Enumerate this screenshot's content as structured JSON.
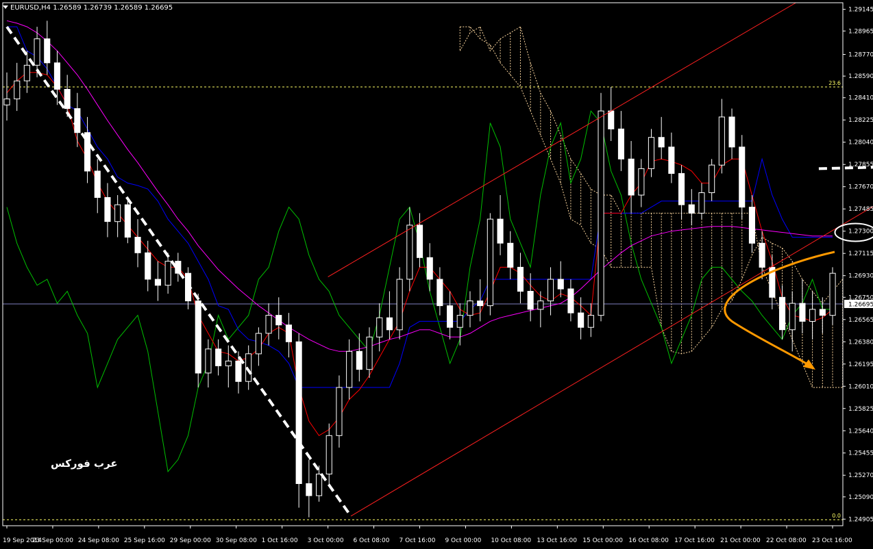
{
  "header": {
    "symbol": "EURUSD,H4",
    "quotes": "1.26589 1.26739 1.26589 1.26695"
  },
  "watermark": "عرب فوركس",
  "colors": {
    "background": "#000000",
    "axis": "#ffffff",
    "candle": "#ffffff",
    "tenkan": "#ff0000",
    "kijun": "#0000ff",
    "chikou": "#00c000",
    "ma": "#ff00ff",
    "cloud": "#ffd9a0",
    "fib": "#ffff66",
    "channel": "#ff2020",
    "trend_marker": "#ffffff",
    "forecast_arrow": "#ff9900",
    "price_line": "#8080c0"
  },
  "chart_data": {
    "type": "candlestick",
    "symbol": "EURUSD",
    "timeframe": "H4",
    "ylim": [
      1.2485,
      1.292
    ],
    "y_ticks": [
      "1.29145",
      "1.28965",
      "1.28770",
      "1.28590",
      "1.28410",
      "1.28225",
      "1.28040",
      "1.27855",
      "1.27670",
      "1.27485",
      "1.27300",
      "1.27115",
      "1.26930",
      "1.26750",
      "1.26565",
      "1.26380",
      "1.26195",
      "1.26010",
      "1.25825",
      "1.25640",
      "1.25455",
      "1.25270",
      "1.25090",
      "1.24905"
    ],
    "x_ticks": [
      "19 Sep 2014",
      "23 Sep 00:00",
      "24 Sep 08:00",
      "25 Sep 16:00",
      "29 Sep 00:00",
      "30 Sep 08:00",
      "1 Oct 16:00",
      "3 Oct 00:00",
      "6 Oct 08:00",
      "7 Oct 16:00",
      "9 Oct 00:00",
      "10 Oct 08:00",
      "13 Oct 16:00",
      "15 Oct 00:00",
      "16 Oct 08:00",
      "17 Oct 16:00",
      "21 Oct 00:00",
      "22 Oct 08:00",
      "23 Oct 16:00"
    ],
    "current_price": "1.26695",
    "fib_levels": [
      {
        "label": "23.6",
        "price": 1.285
      },
      {
        "label": "0.0",
        "price": 1.249
      }
    ],
    "annotations": [
      {
        "type": "trendline",
        "style": "dashed-white",
        "from": [
          0.0,
          1.29
        ],
        "to": [
          7.5,
          1.2493
        ]
      },
      {
        "type": "channel",
        "color": "red",
        "lower_from": [
          7.5,
          1.2493
        ],
        "lower_to": [
          19.3,
          1.276
        ],
        "upper_from": [
          7.0,
          1.2692
        ],
        "upper_to": [
          17.2,
          1.292
        ]
      },
      {
        "type": "dash-marker",
        "at": [
          17.7,
          1.2782
        ]
      },
      {
        "type": "ellipse-marker",
        "at": [
          18.5,
          1.2729
        ]
      },
      {
        "type": "forecast-arrow",
        "color": "orange"
      }
    ],
    "series": [
      {
        "name": "price",
        "kind": "candles",
        "ohlc": [
          [
            1.2835,
            1.2862,
            1.2822,
            1.284
          ],
          [
            1.284,
            1.287,
            1.283,
            1.2855
          ],
          [
            1.2855,
            1.288,
            1.2845,
            1.2868
          ],
          [
            1.2868,
            1.29,
            1.2858,
            1.289
          ],
          [
            1.289,
            1.2905,
            1.286,
            1.287
          ],
          [
            1.287,
            1.288,
            1.2835,
            1.2848
          ],
          [
            1.2848,
            1.286,
            1.2825,
            1.2832
          ],
          [
            1.2832,
            1.2845,
            1.28,
            1.2812
          ],
          [
            1.2812,
            1.2825,
            1.277,
            1.278
          ],
          [
            1.278,
            1.279,
            1.2745,
            1.2758
          ],
          [
            1.2758,
            1.277,
            1.2725,
            1.2738
          ],
          [
            1.2738,
            1.276,
            1.2725,
            1.2752
          ],
          [
            1.2752,
            1.2758,
            1.272,
            1.2725
          ],
          [
            1.2725,
            1.274,
            1.27,
            1.2712
          ],
          [
            1.2712,
            1.2722,
            1.268,
            1.269
          ],
          [
            1.269,
            1.2705,
            1.2672,
            1.2685
          ],
          [
            1.2685,
            1.2712,
            1.2678,
            1.2705
          ],
          [
            1.2705,
            1.2712,
            1.2688,
            1.2695
          ],
          [
            1.2695,
            1.27,
            1.2665,
            1.2672
          ],
          [
            1.2672,
            1.2678,
            1.26,
            1.2612
          ],
          [
            1.2612,
            1.264,
            1.26,
            1.2632
          ],
          [
            1.2632,
            1.264,
            1.261,
            1.2618
          ],
          [
            1.2618,
            1.2635,
            1.26,
            1.2622
          ],
          [
            1.2622,
            1.263,
            1.2595,
            1.2605
          ],
          [
            1.2605,
            1.2635,
            1.2598,
            1.2628
          ],
          [
            1.2628,
            1.265,
            1.2618,
            1.2645
          ],
          [
            1.2645,
            1.267,
            1.2635,
            1.266
          ],
          [
            1.266,
            1.2675,
            1.264,
            1.2652
          ],
          [
            1.2652,
            1.2662,
            1.2625,
            1.2638
          ],
          [
            1.2638,
            1.2645,
            1.25,
            1.252
          ],
          [
            1.252,
            1.254,
            1.2492,
            1.251
          ],
          [
            1.251,
            1.2535,
            1.2505,
            1.2528
          ],
          [
            1.2528,
            1.257,
            1.2518,
            1.256
          ],
          [
            1.256,
            1.261,
            1.255,
            1.26
          ],
          [
            1.26,
            1.264,
            1.259,
            1.263
          ],
          [
            1.263,
            1.2645,
            1.2605,
            1.2615
          ],
          [
            1.2615,
            1.265,
            1.2608,
            1.2642
          ],
          [
            1.2642,
            1.267,
            1.263,
            1.2658
          ],
          [
            1.2658,
            1.268,
            1.264,
            1.2648
          ],
          [
            1.2648,
            1.27,
            1.264,
            1.269
          ],
          [
            1.269,
            1.275,
            1.268,
            1.2735
          ],
          [
            1.2735,
            1.2745,
            1.27,
            1.2708
          ],
          [
            1.2708,
            1.272,
            1.268,
            1.269
          ],
          [
            1.269,
            1.27,
            1.266,
            1.2668
          ],
          [
            1.2668,
            1.268,
            1.264,
            1.265
          ],
          [
            1.265,
            1.267,
            1.2635,
            1.266
          ],
          [
            1.266,
            1.268,
            1.265,
            1.2672
          ],
          [
            1.2672,
            1.269,
            1.2655,
            1.2668
          ],
          [
            1.2668,
            1.2745,
            1.266,
            1.274
          ],
          [
            1.274,
            1.276,
            1.271,
            1.272
          ],
          [
            1.272,
            1.273,
            1.269,
            1.27
          ],
          [
            1.27,
            1.2712,
            1.267,
            1.268
          ],
          [
            1.268,
            1.2695,
            1.2655,
            1.2665
          ],
          [
            1.2665,
            1.268,
            1.265,
            1.2672
          ],
          [
            1.2672,
            1.27,
            1.266,
            1.269
          ],
          [
            1.269,
            1.2705,
            1.2675,
            1.2682
          ],
          [
            1.2682,
            1.269,
            1.2655,
            1.2662
          ],
          [
            1.2662,
            1.2675,
            1.264,
            1.265
          ],
          [
            1.265,
            1.267,
            1.2642,
            1.266
          ],
          [
            1.266,
            1.2845,
            1.2655,
            1.283
          ],
          [
            1.283,
            1.285,
            1.2805,
            1.2815
          ],
          [
            1.2815,
            1.283,
            1.278,
            1.279
          ],
          [
            1.279,
            1.2805,
            1.2745,
            1.276
          ],
          [
            1.276,
            1.279,
            1.275,
            1.2782
          ],
          [
            1.2782,
            1.2815,
            1.2775,
            1.2808
          ],
          [
            1.2808,
            1.2825,
            1.279,
            1.28
          ],
          [
            1.28,
            1.2812,
            1.277,
            1.2778
          ],
          [
            1.2778,
            1.2785,
            1.274,
            1.2752
          ],
          [
            1.2752,
            1.2765,
            1.2735,
            1.2745
          ],
          [
            1.2745,
            1.277,
            1.274,
            1.2762
          ],
          [
            1.2762,
            1.279,
            1.2755,
            1.2785
          ],
          [
            1.2785,
            1.284,
            1.2778,
            1.2825
          ],
          [
            1.2825,
            1.2832,
            1.279,
            1.28
          ],
          [
            1.28,
            1.281,
            1.274,
            1.275
          ],
          [
            1.275,
            1.276,
            1.2712,
            1.272
          ],
          [
            1.272,
            1.273,
            1.269,
            1.27
          ],
          [
            1.27,
            1.271,
            1.2665,
            1.2675
          ],
          [
            1.2675,
            1.2685,
            1.264,
            1.2648
          ],
          [
            1.2648,
            1.268,
            1.263,
            1.267
          ],
          [
            1.267,
            1.269,
            1.2645,
            1.2655
          ],
          [
            1.2655,
            1.268,
            1.264,
            1.2665
          ],
          [
            1.2665,
            1.2675,
            1.2645,
            1.266
          ],
          [
            1.266,
            1.27,
            1.2652,
            1.2695
          ]
        ]
      },
      {
        "name": "tenkan",
        "kind": "line",
        "color": "#ff0000",
        "values": [
          1.2845,
          1.2855,
          1.2862,
          1.2862,
          1.286,
          1.285,
          1.2835,
          1.2805,
          1.279,
          1.277,
          1.2755,
          1.2745,
          1.2735,
          1.2725,
          1.2715,
          1.2705,
          1.27,
          1.27,
          1.269,
          1.266,
          1.2645,
          1.263,
          1.2628,
          1.2622,
          1.2625,
          1.2632,
          1.2645,
          1.265,
          1.2645,
          1.26,
          1.2572,
          1.256,
          1.2565,
          1.2575,
          1.259,
          1.2598,
          1.261,
          1.2625,
          1.264,
          1.2655,
          1.268,
          1.27,
          1.27,
          1.269,
          1.268,
          1.2665,
          1.266,
          1.2662,
          1.268,
          1.27,
          1.27,
          1.2695,
          1.2685,
          1.2676,
          1.2672,
          1.2678,
          1.2675,
          1.2668,
          1.266,
          1.2745,
          1.2745,
          1.2745,
          1.276,
          1.277,
          1.2788,
          1.279,
          1.2788,
          1.2785,
          1.278,
          1.277,
          1.277,
          1.2785,
          1.279,
          1.279,
          1.276,
          1.273,
          1.2705,
          1.2675,
          1.266,
          1.2658,
          1.2655,
          1.2658,
          1.2665
        ]
      },
      {
        "name": "kijun",
        "kind": "line",
        "color": "#0000ff",
        "values": [
          1.29,
          1.29,
          1.288,
          1.2875,
          1.2865,
          1.285,
          1.2835,
          1.283,
          1.2815,
          1.28,
          1.279,
          1.2775,
          1.277,
          1.2768,
          1.2765,
          1.2755,
          1.274,
          1.273,
          1.272,
          1.2705,
          1.269,
          1.2668,
          1.2665,
          1.2648,
          1.264,
          1.2638,
          1.2635,
          1.263,
          1.262,
          1.26,
          1.26,
          1.26,
          1.26,
          1.26,
          1.26,
          1.26,
          1.26,
          1.26,
          1.26,
          1.262,
          1.265,
          1.2655,
          1.2655,
          1.2655,
          1.2655,
          1.2655,
          1.2665,
          1.2672,
          1.269,
          1.269,
          1.269,
          1.269,
          1.269,
          1.269,
          1.269,
          1.269,
          1.269,
          1.269,
          1.269,
          1.2745,
          1.2745,
          1.2745,
          1.2745,
          1.2745,
          1.275,
          1.2755,
          1.2755,
          1.2755,
          1.2755,
          1.2755,
          1.2755,
          1.2755,
          1.2755,
          1.2755,
          1.2755,
          1.279,
          1.276,
          1.274,
          1.2725,
          1.2725,
          1.2725,
          1.2725,
          1.2725
        ]
      },
      {
        "name": "chikou",
        "kind": "line",
        "color": "#00c000",
        "values": [
          1.275,
          1.272,
          1.27,
          1.2685,
          1.269,
          1.267,
          1.268,
          1.266,
          1.2645,
          1.26,
          1.262,
          1.264,
          1.265,
          1.266,
          1.263,
          1.258,
          1.253,
          1.254,
          1.256,
          1.26,
          1.262,
          1.266,
          1.264,
          1.265,
          1.266,
          1.269,
          1.27,
          1.273,
          1.275,
          1.274,
          1.271,
          1.269,
          1.268,
          1.266,
          1.265,
          1.264,
          1.263,
          1.266,
          1.27,
          1.274,
          1.275,
          1.272,
          1.268,
          1.265,
          1.262,
          1.264,
          1.27,
          1.274,
          1.282,
          1.28,
          1.274,
          1.272,
          1.27,
          1.276,
          1.28,
          1.282,
          1.277,
          1.279,
          1.283,
          1.282,
          1.278,
          1.276,
          1.272,
          1.269,
          1.267,
          1.265,
          1.262,
          1.264,
          1.266,
          1.269,
          1.27,
          1.27,
          1.269,
          1.268,
          1.2672,
          1.266,
          1.265,
          1.264,
          1.266,
          1.267,
          1.269,
          1.2665,
          1.2665
        ]
      },
      {
        "name": "ma",
        "kind": "line",
        "color": "#ff00ff",
        "values": [
          1.2905,
          1.2903,
          1.29,
          1.2895,
          1.2888,
          1.288,
          1.287,
          1.286,
          1.2848,
          1.2835,
          1.2822,
          1.281,
          1.2798,
          1.2787,
          1.2775,
          1.2763,
          1.2752,
          1.274,
          1.273,
          1.2718,
          1.2708,
          1.2698,
          1.269,
          1.2682,
          1.2675,
          1.2668,
          1.2662,
          1.2656,
          1.265,
          1.2645,
          1.264,
          1.2636,
          1.2632,
          1.263,
          1.263,
          1.2632,
          1.2634,
          1.2637,
          1.264,
          1.2642,
          1.2645,
          1.2648,
          1.2648,
          1.2645,
          1.2642,
          1.2642,
          1.2645,
          1.265,
          1.2655,
          1.2658,
          1.266,
          1.2662,
          1.2664,
          1.2666,
          1.2668,
          1.267,
          1.2675,
          1.2682,
          1.269,
          1.2698,
          1.2705,
          1.2712,
          1.2718,
          1.2722,
          1.2726,
          1.2728,
          1.273,
          1.2731,
          1.2732,
          1.2733,
          1.2734,
          1.2734,
          1.2734,
          1.2733,
          1.2732,
          1.2731,
          1.273,
          1.2729,
          1.2728,
          1.2727,
          1.2726,
          1.2726,
          1.2726
        ]
      },
      {
        "name": "senkou_a",
        "kind": "cloud-edge",
        "color": "#ffd9a0",
        "values": [
          1.29,
          1.29,
          1.289,
          1.2885,
          1.287,
          1.286,
          1.285,
          1.283,
          1.281,
          1.279,
          1.277,
          1.274,
          1.2735,
          1.272,
          1.2715,
          1.27,
          1.27,
          1.27,
          1.27,
          1.27,
          1.265,
          1.263,
          1.2628,
          1.263,
          1.264,
          1.265,
          1.2665,
          1.2672,
          1.269,
          1.271,
          1.2725,
          1.272,
          1.2716,
          1.2705,
          1.269,
          1.268,
          1.267,
          1.268,
          1.269,
          1.2695,
          1.2695,
          1.2695,
          1.2695,
          1.2695,
          1.27,
          1.2715,
          1.272,
          1.2715,
          1.271,
          1.27,
          1.27,
          1.27,
          1.272,
          1.2732,
          1.274,
          1.2744,
          1.2744,
          1.2744,
          1.2745,
          1.2744,
          1.2744,
          1.276,
          1.2762,
          1.2766
        ]
      },
      {
        "name": "senkou_b",
        "kind": "cloud-edge",
        "color": "#ffd9a0",
        "values": [
          1.288,
          1.2895,
          1.29,
          1.288,
          1.289,
          1.2895,
          1.29,
          1.287,
          1.2845,
          1.283,
          1.281,
          1.279,
          1.2778,
          1.2765,
          1.276,
          1.276,
          1.2745,
          1.2745,
          1.2745,
          1.2745,
          1.2745,
          1.2745,
          1.2745,
          1.2745,
          1.2745,
          1.2745,
          1.2745,
          1.2745,
          1.2745,
          1.2745,
          1.27,
          1.268,
          1.266,
          1.264,
          1.262,
          1.26,
          1.26,
          1.26,
          1.26,
          1.26,
          1.26,
          1.26,
          1.262,
          1.264,
          1.265,
          1.265,
          1.265,
          1.265,
          1.265,
          1.265,
          1.265,
          1.265,
          1.265,
          1.265,
          1.265,
          1.265,
          1.265,
          1.265,
          1.265,
          1.265,
          1.265,
          1.265,
          1.265,
          1.265
        ]
      }
    ]
  }
}
